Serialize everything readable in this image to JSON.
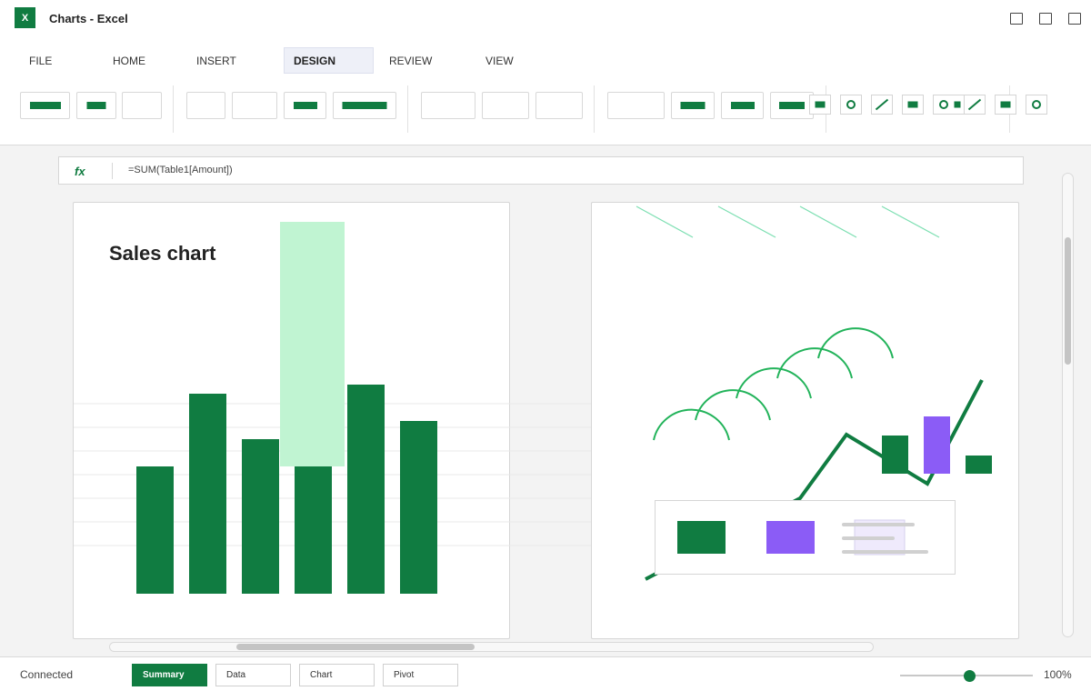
{
  "window": {
    "app_icon_letter": "X",
    "title": "Charts - Excel"
  },
  "tabs": [
    "FILE",
    "HOME",
    "INSERT",
    "DESIGN",
    "REVIEW",
    "VIEW"
  ],
  "active_tab": "DESIGN",
  "formula_bar": {
    "fx_label": "fx",
    "formula": "=SUM(Table1[Amount])"
  },
  "left_chart": {
    "title": "Sales chart",
    "chart_data": {
      "type": "bar",
      "title": "Sales chart",
      "series": [
        {
          "values": [
            28,
            44,
            34,
            28,
            46,
            38
          ]
        }
      ],
      "highlight": {
        "index": 3,
        "value": 54,
        "base": 28,
        "color": "#c0f4d2"
      },
      "grid": true
    }
  },
  "right_chart": {
    "colors": {
      "primary": "#107c41",
      "accent": "#8b5cf6",
      "arc": "#22b35a",
      "hatch": "#7ddfb2"
    }
  },
  "sheets": [
    "Summary",
    "Data",
    "Chart",
    "Pivot"
  ],
  "active_sheet": "Summary",
  "status": {
    "text": "Connected",
    "zoom": "100%",
    "zoom_fraction": 0.52
  },
  "colors": {
    "brand": "#107c41",
    "highlight": "#c0f4d2",
    "accent": "#8b5cf6"
  }
}
